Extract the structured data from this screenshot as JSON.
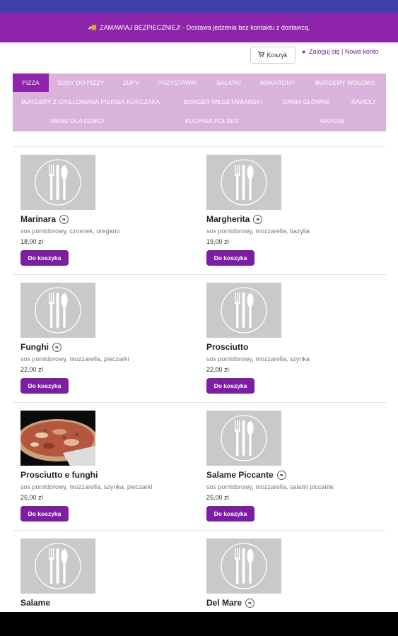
{
  "banner": {
    "text": "ZAMAWIAJ BEZPIECZNIEJ! - Dostawa jedzenia bez kontaktu z dostawcą."
  },
  "topbar": {
    "cart_label": "Koszyk",
    "login_label": "Zaloguj się",
    "separator": "|",
    "register_label": "Nowe konto"
  },
  "nav": {
    "items": [
      "PIZZA",
      "SOSY DO PIZZY",
      "ZUPY",
      "PRZYSTAWKI",
      "SAŁATKI",
      "MAKARONY",
      "BURGERY WOŁOWE",
      "BURGERY Z GRILLOWANĄ PIERSIĄ KURCZAKA",
      "BURGER WEGETARIAŃSKI",
      "DANIA GŁÓWNE",
      "RAVIOLI",
      "MENU DLA DZIECI",
      "KUCHNIA POLSKA",
      "NAPOJE"
    ],
    "active": "PIZZA"
  },
  "products": [
    {
      "name": "Marinara",
      "veg": true,
      "desc": "sos pomidorowy, czosnek, oregano",
      "price": "18,00 zł",
      "button": "Do koszyka",
      "image": "placeholder"
    },
    {
      "name": "Margherita",
      "veg": true,
      "desc": "sos pomidorowy, mozzarella, bazylia",
      "price": "19,00 zł",
      "button": "Do koszyka",
      "image": "placeholder"
    },
    {
      "name": "Funghi",
      "veg": true,
      "desc": "sos pomidorowy, mozzarella, pieczarki",
      "price": "22,00 zł",
      "button": "Do koszyka",
      "image": "placeholder"
    },
    {
      "name": "Prosciutto",
      "veg": false,
      "desc": "sos pomidorowy, mozzarella, szynka",
      "price": "22,00 zł",
      "button": "Do koszyka",
      "image": "placeholder"
    },
    {
      "name": "Prosciutto e funghi",
      "veg": false,
      "desc": "sos pomidorowy, mozzarella, szynka, pieczarki",
      "price": "25,00 zł",
      "button": "Do koszyka",
      "image": "photo"
    },
    {
      "name": "Salame Piccante",
      "veg": true,
      "desc": "sos pomidorowy, mozzarella, salami piccante",
      "price": "25,00 zł",
      "button": "Do koszyka",
      "image": "placeholder"
    },
    {
      "name": "Salame",
      "veg": false,
      "desc": "",
      "price": "",
      "button": "",
      "image": "placeholder"
    },
    {
      "name": "Del Mare",
      "veg": true,
      "desc": "",
      "price": "",
      "button": "",
      "image": "placeholder"
    }
  ],
  "icons": {
    "cart": "cart-icon",
    "user": "user-icon",
    "truck": "truck-icon",
    "veg": "leaf-icon",
    "placeholder": "cutlery-icon"
  },
  "colors": {
    "brand_purple": "#8e24aa",
    "button_purple": "#7b1fa2",
    "nav_bg": "#d9b3da",
    "status_bar": "#3f3fa8"
  }
}
